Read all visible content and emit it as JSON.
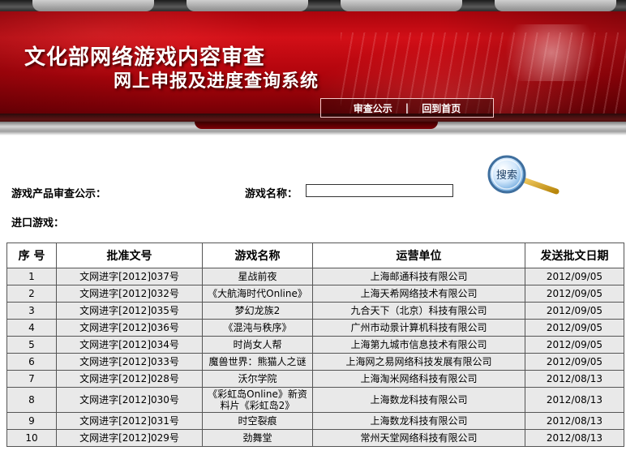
{
  "header": {
    "title_line1": "文化部网络游戏内容审查",
    "title_line2": "网上申报及进度查询系统",
    "nav": {
      "announce": "审查公示",
      "separator": "|",
      "home": "回到首页"
    }
  },
  "search": {
    "announce_label": "游戏产品审查公示：",
    "name_label": "游戏名称：",
    "name_value": "",
    "button_label": "搜索"
  },
  "section": {
    "import_label": "进口游戏："
  },
  "table": {
    "headers": [
      "序 号",
      "批准文号",
      "游戏名称",
      "运营单位",
      "发送批文日期"
    ],
    "rows": [
      [
        "1",
        "文网进字[2012]037号",
        "星战前夜",
        "上海邮通科技有限公司",
        "2012/09/05"
      ],
      [
        "2",
        "文网进字[2012]032号",
        "《大航海时代Online》",
        "上海天希网络技术有限公司",
        "2012/09/05"
      ],
      [
        "3",
        "文网进字[2012]035号",
        "梦幻龙族2",
        "九合天下（北京）科技有限公司",
        "2012/09/05"
      ],
      [
        "4",
        "文网进字[2012]036号",
        "《混沌与秩序》",
        "广州市动景计算机科技有限公司",
        "2012/09/05"
      ],
      [
        "5",
        "文网进字[2012]034号",
        "时尚女人帮",
        "上海第九城市信息技术有限公司",
        "2012/09/05"
      ],
      [
        "6",
        "文网进字[2012]033号",
        "魔兽世界：熊猫人之谜",
        "上海网之易网络科技发展有限公司",
        "2012/09/05"
      ],
      [
        "7",
        "文网进字[2012]028号",
        "沃尔学院",
        "上海淘米网络科技有限公司",
        "2012/08/13"
      ],
      [
        "8",
        "文网进字[2012]030号",
        "《彩虹岛Online》新资料片《彩虹岛2》",
        "上海数龙科技有限公司",
        "2012/08/13"
      ],
      [
        "9",
        "文网进字[2012]031号",
        "时空裂痕",
        "上海数龙科技有限公司",
        "2012/08/13"
      ],
      [
        "10",
        "文网进字[2012]029号",
        "劲舞堂",
        "常州天堂网络科技有限公司",
        "2012/08/13"
      ]
    ]
  }
}
